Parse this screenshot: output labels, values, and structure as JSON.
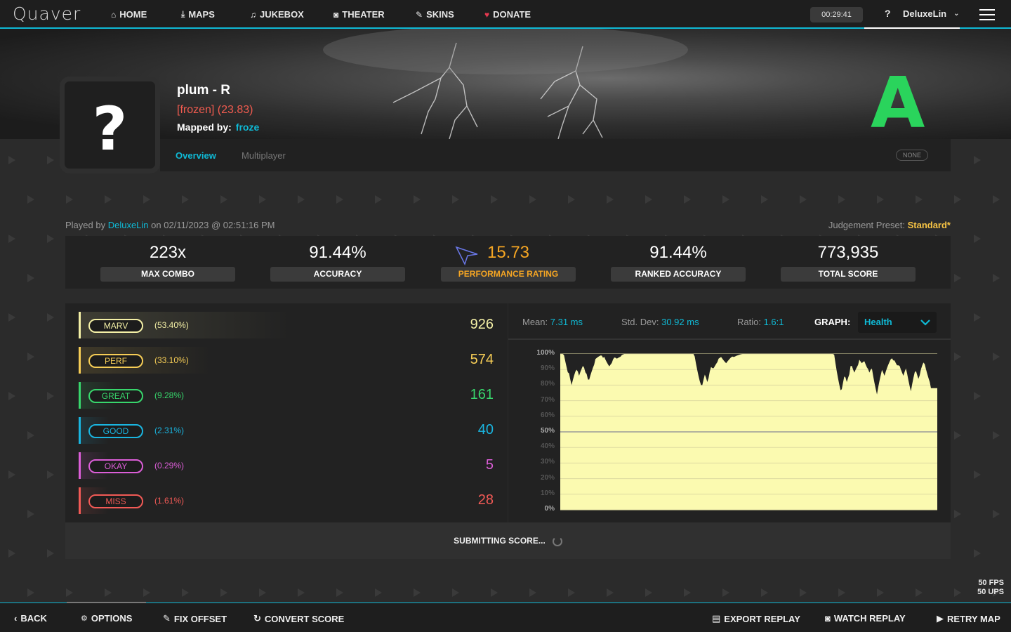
{
  "nav": {
    "logo": "Quaver",
    "items": [
      {
        "label": "HOME",
        "icon": "home-icon"
      },
      {
        "label": "MAPS",
        "icon": "download-icon"
      },
      {
        "label": "JUKEBOX",
        "icon": "music-icon"
      },
      {
        "label": "THEATER",
        "icon": "camera-icon"
      },
      {
        "label": "SKINS",
        "icon": "brush-icon"
      },
      {
        "label": "DONATE",
        "icon": "heart-icon"
      }
    ],
    "timer": "00:29:41",
    "help": "?",
    "username": "DeluxeLin"
  },
  "map": {
    "title": "plum - R",
    "difficulty": "[frozen] (23.83)",
    "mapped_by_label": "Mapped by:",
    "creator": "froze",
    "grade": "A",
    "avatar_glyph": "?"
  },
  "tabs": [
    {
      "label": "Overview",
      "active": true
    },
    {
      "label": "Multiplayer",
      "active": false
    }
  ],
  "mods_badge": "NONE",
  "played": {
    "prefix": "Played by",
    "player": "DeluxeLin",
    "suffix": "on 02/11/2023 @ 02:51:16 PM",
    "preset_label": "Judgement Preset:",
    "preset_value": "Standard*"
  },
  "stats": [
    {
      "value": "223x",
      "label": "MAX COMBO"
    },
    {
      "value": "91.44%",
      "label": "ACCURACY"
    },
    {
      "value": "15.73",
      "label": "PERFORMANCE RATING"
    },
    {
      "value": "91.44%",
      "label": "RANKED ACCURACY"
    },
    {
      "value": "773,935",
      "label": "TOTAL SCORE"
    }
  ],
  "judgements": [
    {
      "name": "MARV",
      "pct": "(53.40%)",
      "count": "926",
      "color": "#f4f0a6",
      "ratio": 0.534
    },
    {
      "name": "PERF",
      "pct": "(33.10%)",
      "count": "574",
      "color": "#f6cd56",
      "ratio": 0.331
    },
    {
      "name": "GREAT",
      "pct": "(9.28%)",
      "count": "161",
      "color": "#38d66c",
      "ratio": 0.0928
    },
    {
      "name": "GOOD",
      "pct": "(2.31%)",
      "count": "40",
      "color": "#1ab5e0",
      "ratio": 0.0231
    },
    {
      "name": "OKAY",
      "pct": "(0.29%)",
      "count": "5",
      "color": "#dc5ed8",
      "ratio": 0.0029
    },
    {
      "name": "MISS",
      "pct": "(1.61%)",
      "count": "28",
      "color": "#f25a56",
      "ratio": 0.0161
    }
  ],
  "graph_stats": {
    "mean_label": "Mean:",
    "mean": "7.31 ms",
    "std_label": "Std. Dev:",
    "std": "30.92 ms",
    "ratio_label": "Ratio:",
    "ratio": "1.6:1",
    "graph_label": "GRAPH:",
    "graph_selected": "Health"
  },
  "graph": {
    "y_labels": [
      "100%",
      "90%",
      "80%",
      "70%",
      "60%",
      "50%",
      "40%",
      "30%",
      "20%",
      "10%",
      "0%"
    ],
    "fill_color": "#fbfab0"
  },
  "submitting": "SUBMITTING SCORE...",
  "perf": {
    "fps": "50 FPS",
    "ups": "50 UPS"
  },
  "bottom": {
    "back": "BACK",
    "options": "OPTIONS",
    "fix_offset": "FIX OFFSET",
    "convert_score": "CONVERT SCORE",
    "export_replay": "EXPORT REPLAY",
    "watch_replay": "WATCH REPLAY",
    "retry_map": "RETRY MAP"
  }
}
